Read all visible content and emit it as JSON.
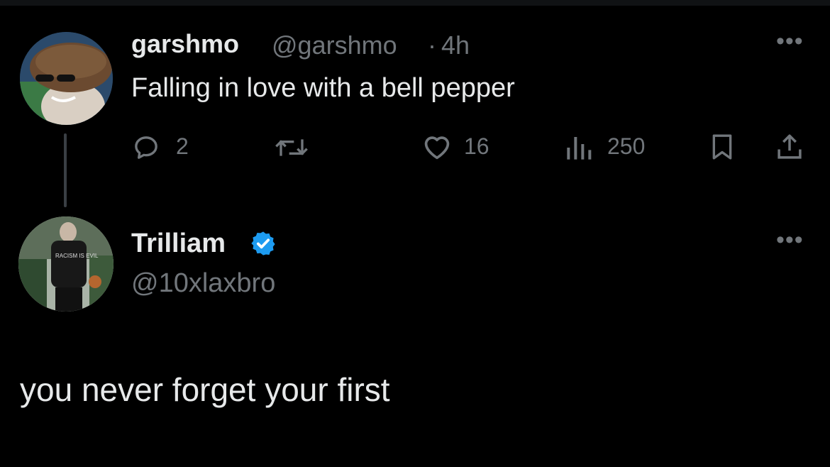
{
  "tweet": {
    "display_name": "garshmo",
    "handle": "@garshmo",
    "separator": "·",
    "time": "4h",
    "text": "Falling in love with a bell pepper",
    "actions": {
      "replies": "2",
      "likes": "16",
      "views": "250"
    },
    "icons": [
      "reply-icon",
      "retweet-icon",
      "like-icon",
      "views-icon",
      "bookmark-icon",
      "share-icon",
      "more-icon"
    ]
  },
  "reply": {
    "display_name": "Trilliam",
    "handle": "@10xlaxbro",
    "verified": true,
    "text": "you never forget your first"
  },
  "colors": {
    "background": "#000000",
    "primary_text": "#e7e9ea",
    "secondary_text": "#71767b",
    "verified_blue": "#1d9bf0"
  }
}
